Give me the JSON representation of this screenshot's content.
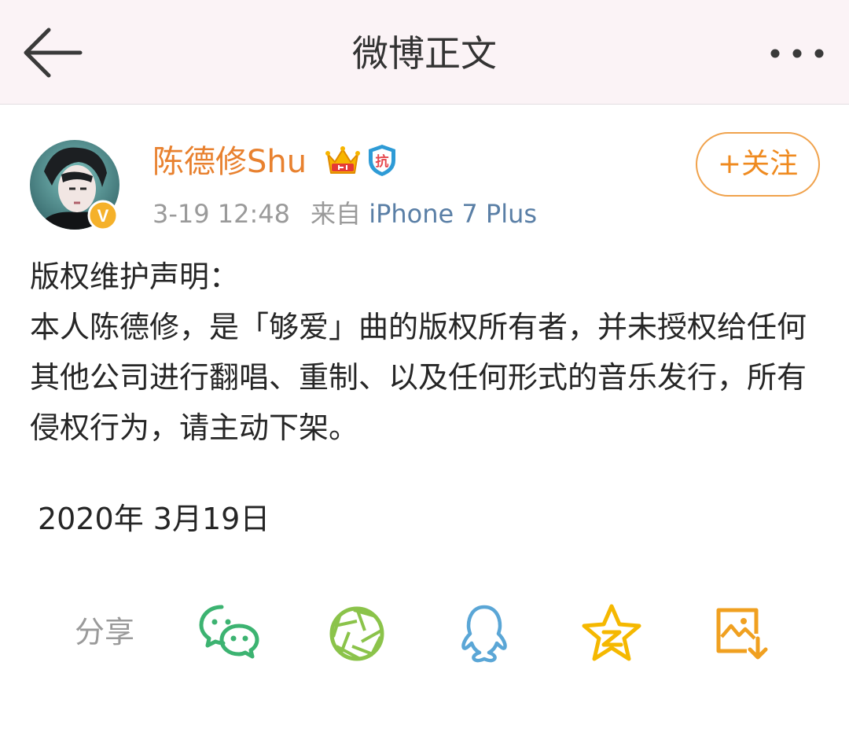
{
  "header": {
    "title": "微博正文",
    "back_icon": "arrow-left-icon",
    "more_icon": "more-dots-icon"
  },
  "post": {
    "author": {
      "name": "陈德修Shu",
      "verified_badge_letter": "V",
      "badge_icons": [
        "crown-icon",
        "shield-icon"
      ],
      "shield_text": "抗"
    },
    "time": "3-19 12:48",
    "source_prefix": "来自",
    "device": "iPhone 7 Plus",
    "follow_label": "+关注",
    "paragraphs": [
      "版权维护声明：",
      "本人陈德修，是「够爱」曲的版权所有者，并未授权给任何其他公司进行翻唱、重制、以及任何形式的音乐发行，所有侵权行为，请主动下架。"
    ],
    "date": "2020年 3月19日"
  },
  "share": {
    "label": "分享",
    "targets": [
      "wechat-icon",
      "moments-icon",
      "qq-icon",
      "qzone-icon",
      "save-image-icon"
    ]
  },
  "colors": {
    "accent_orange": "#ef8a1f",
    "username_orange": "#e8812f",
    "link_blue": "#5a7fa6",
    "header_bg": "#fbf3f6",
    "wechat_green": "#3cb371",
    "moments_green": "#8bc34a",
    "qq_blue": "#5aa6d6",
    "qzone_gold": "#f5b800"
  }
}
